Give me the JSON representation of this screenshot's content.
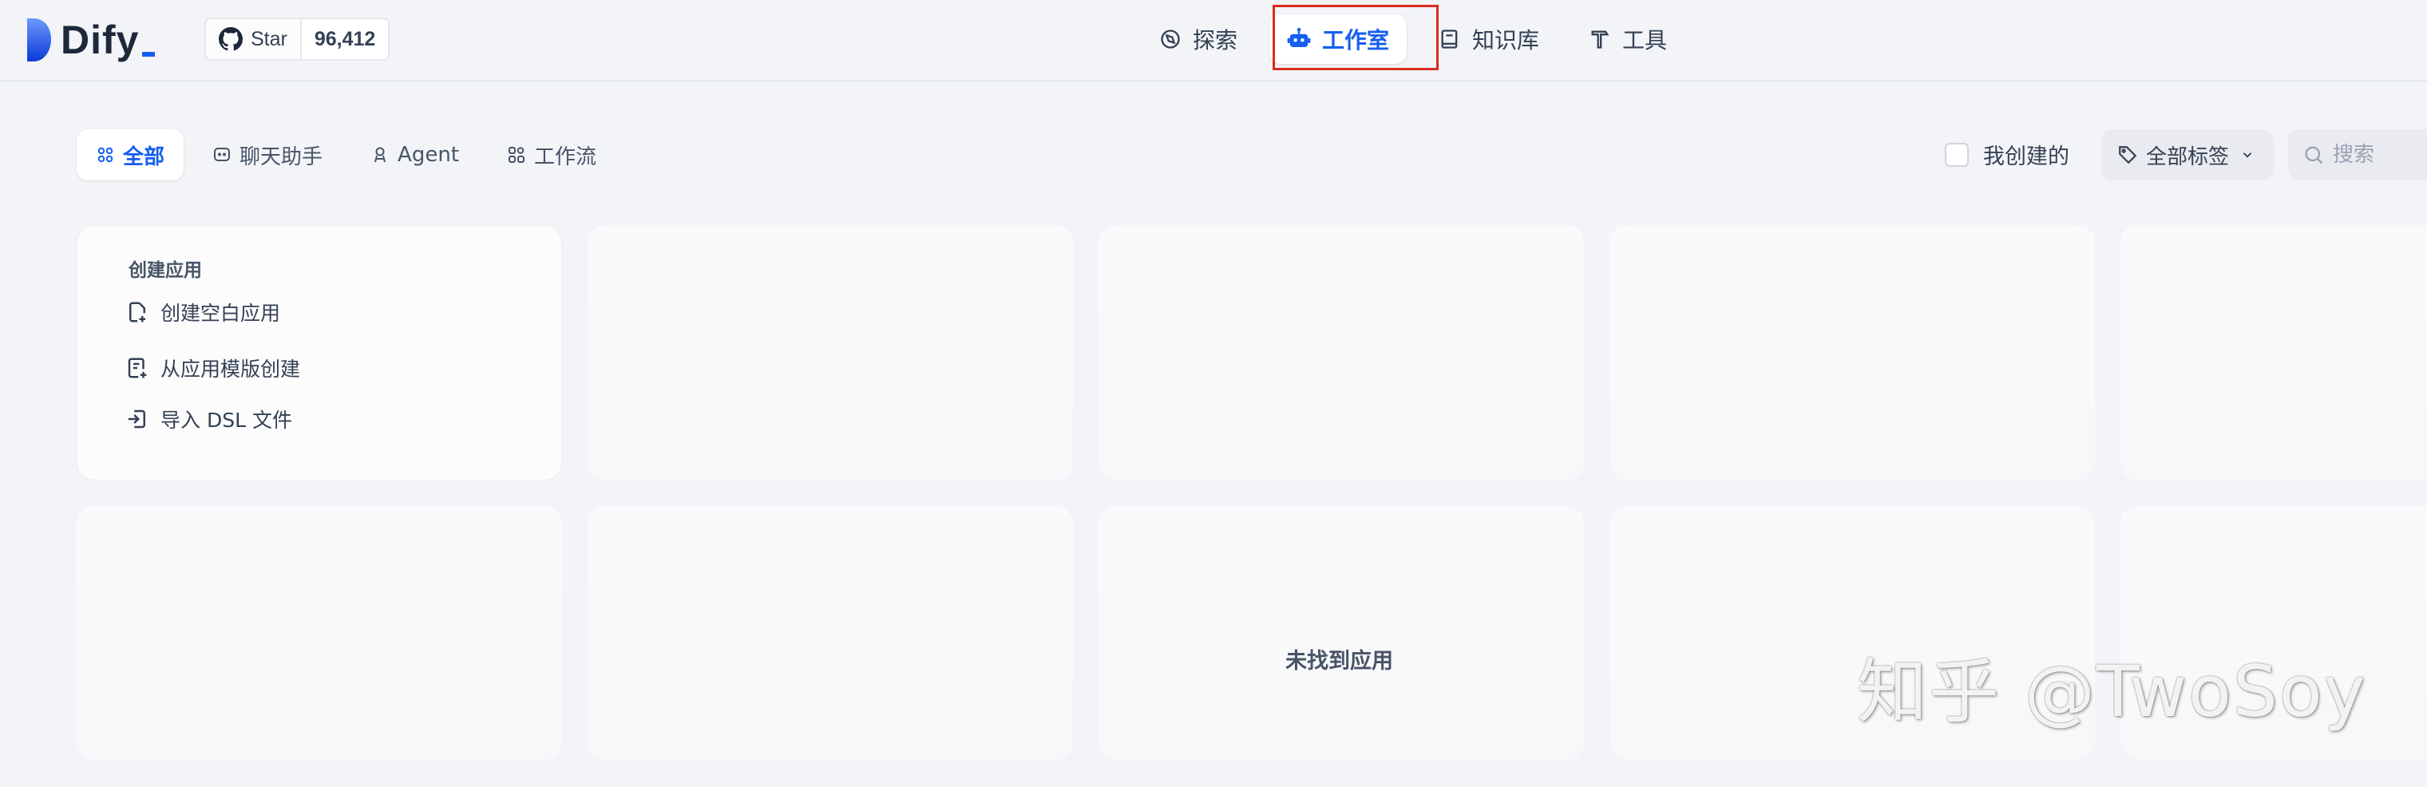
{
  "header": {
    "logo_text": "Dify",
    "github": {
      "star_label": "Star",
      "star_count": "96,412"
    },
    "nav": [
      {
        "label": "探索",
        "icon": "compass-icon"
      },
      {
        "label": "工作室",
        "icon": "robot-icon",
        "active": true
      },
      {
        "label": "知识库",
        "icon": "book-icon"
      },
      {
        "label": "工具",
        "icon": "hammer-icon"
      }
    ]
  },
  "filters": {
    "tabs": [
      {
        "label": "全部",
        "icon": "grid-icon",
        "active": true
      },
      {
        "label": "聊天助手",
        "icon": "chat-bubble-icon"
      },
      {
        "label": "Agent",
        "icon": "agent-icon"
      },
      {
        "label": "工作流",
        "icon": "workflow-icon"
      }
    ],
    "mine_label": "我创建的",
    "tag_filter_label": "全部标签",
    "search_placeholder": "搜索"
  },
  "create_card": {
    "title": "创建应用",
    "items": [
      {
        "label": "创建空白应用",
        "icon": "file-plus-icon"
      },
      {
        "label": "从应用模版创建",
        "icon": "template-icon"
      },
      {
        "label": "导入 DSL 文件",
        "icon": "import-icon"
      }
    ]
  },
  "empty_state": "未找到应用",
  "watermark": "知乎 @TwoSoy",
  "colors": {
    "accent": "#155eef",
    "highlight": "#d92d20",
    "background": "#f2f4f7"
  }
}
